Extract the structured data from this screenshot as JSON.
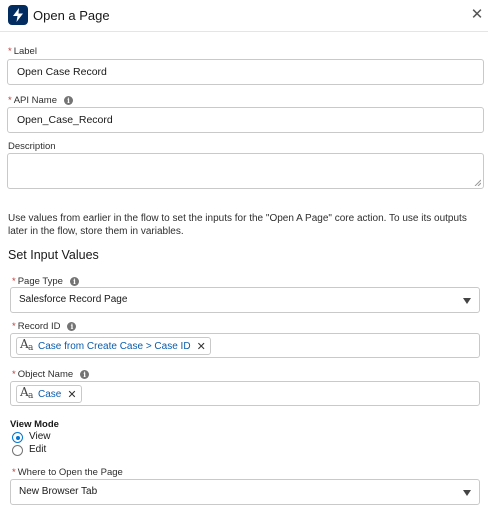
{
  "header": {
    "title": "Open a Page",
    "icon": "lightning-bolt-icon",
    "icon_bg": "#032d60"
  },
  "fields": {
    "label": {
      "label": "Label",
      "required": "*",
      "value": "Open Case Record"
    },
    "api_name": {
      "label": "API Name",
      "required": "*",
      "value": "Open_Case_Record"
    },
    "description": {
      "label": "Description",
      "value": ""
    }
  },
  "help_text": "Use values from earlier in the flow to set the inputs for the \"Open A Page\" core action. To use its outputs later in the flow, store them in variables.",
  "section_title": "Set Input Values",
  "inputs": {
    "page_type": {
      "label": "Page Type",
      "required": "*",
      "value": "Salesforce Record Page"
    },
    "record_id": {
      "label": "Record ID",
      "required": "*",
      "pill": "Case from Create Case > Case ID"
    },
    "object_name": {
      "label": "Object Name",
      "required": "*",
      "pill": "Case"
    },
    "view_mode": {
      "label": "View Mode",
      "options": [
        {
          "label": "View",
          "selected": true
        },
        {
          "label": "Edit",
          "selected": false
        }
      ]
    },
    "where_to_open": {
      "label": "Where to Open the Page",
      "required": "*",
      "value": "New Browser Tab"
    }
  },
  "icons": {
    "info": "i",
    "close": "✕",
    "remove": "✕",
    "aa_big": "A",
    "aa_small": "a"
  },
  "colors": {
    "accent": "#0176d3",
    "required": "#c23934",
    "pill_text": "#0b5cab"
  }
}
